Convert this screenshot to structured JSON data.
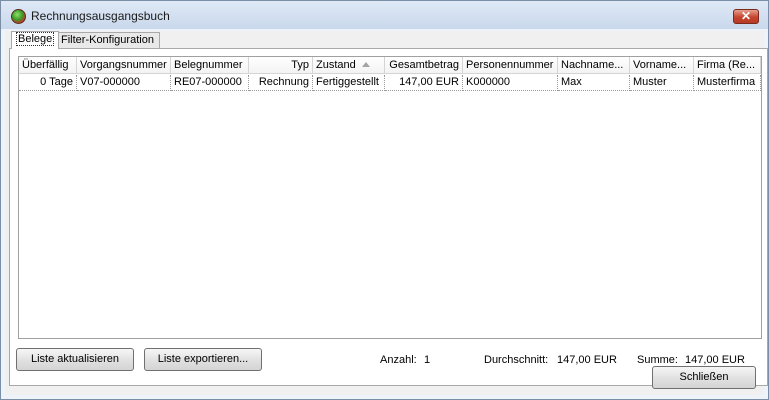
{
  "window": {
    "title": "Rechnungsausgangsbuch",
    "close_symbol": "✕"
  },
  "tabs": [
    "Belege",
    "Filter-Konfiguration"
  ],
  "table": {
    "columns": [
      "Überfällig",
      "Vorgangsnummer",
      "Belegnummer",
      "Typ",
      "Zustand",
      "Gesamtbetrag",
      "Personennummer",
      "Nachname...",
      "Vorname...",
      "Firma (Re..."
    ],
    "rows": [
      [
        "0 Tage",
        "V07-000000",
        "RE07-000000",
        "Rechnung",
        "Fertiggestellt",
        "147,00 EUR",
        "K000000",
        "Max",
        "Muster",
        "Musterfirma"
      ]
    ]
  },
  "buttons": {
    "refresh": "Liste aktualisieren",
    "export": "Liste exportieren...",
    "close": "Schließen"
  },
  "stats": {
    "count_label": "Anzahl:",
    "count_value": "1",
    "avg_label": "Durchschnitt:",
    "avg_value": "147,00 EUR",
    "sum_label": "Summe:",
    "sum_value": "147,00 EUR"
  }
}
